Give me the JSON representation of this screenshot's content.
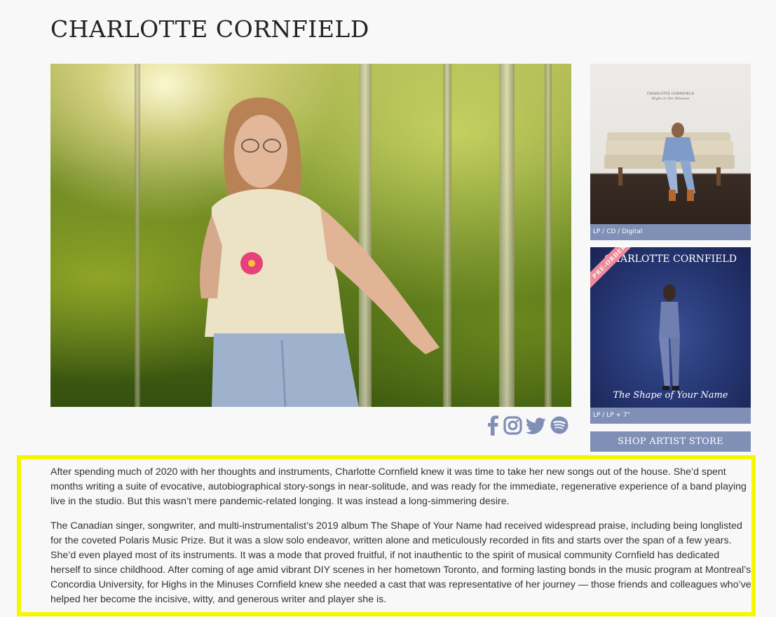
{
  "artist": {
    "name": "CHARLOTTE CORNFIELD"
  },
  "albums": [
    {
      "cover_artist": "CHARLOTTE CORNFIELD",
      "cover_title": "Highs in the Minuses",
      "formats": "LP / CD / Digital"
    },
    {
      "badge": "PRE-ORDER",
      "cover_artist": "CHARLOTTE CORNFIELD",
      "cover_title": "The Shape of Your Name",
      "formats": "LP / LP + 7\""
    }
  ],
  "shop_button": "SHOP ARTIST STORE",
  "social_icons": [
    "facebook-icon",
    "instagram-icon",
    "twitter-icon",
    "spotify-icon"
  ],
  "colors": {
    "accent": "#7f8fb6",
    "highlight": "#f6f600",
    "badge": "#ee8a9a"
  },
  "bio": {
    "p1": "After spending much of 2020 with her thoughts and instruments, Charlotte Cornfield knew it was time to take her new songs out of the house. She’d spent months writing a suite of evocative, autobiographical story-songs in near-solitude, and was ready for the immediate, regenerative experience of a band playing live in the studio. But this wasn’t mere pandemic-related longing. It was instead a long-simmering desire.",
    "p2": "The Canadian singer, songwriter, and multi-instrumentalist’s 2019 album The Shape of Your Name had received widespread praise, including being longlisted for the coveted Polaris Music Prize. But it was a slow solo endeavor, written alone and meticulously recorded in fits and starts over the span of a few years. She’d even played most of its instruments. It was a mode that proved fruitful, if not inauthentic to the spirit of musical community Cornfield has dedicated herself to since childhood. After coming of age amid vibrant DIY scenes in her hometown Toronto, and forming lasting bonds in the music program at Montreal’s Concordia University, for Highs in the Minuses Cornfield knew she needed a cast that was representative of her journey — those friends and colleagues who’ve helped her become the incisive, witty, and generous writer and player she is."
  }
}
